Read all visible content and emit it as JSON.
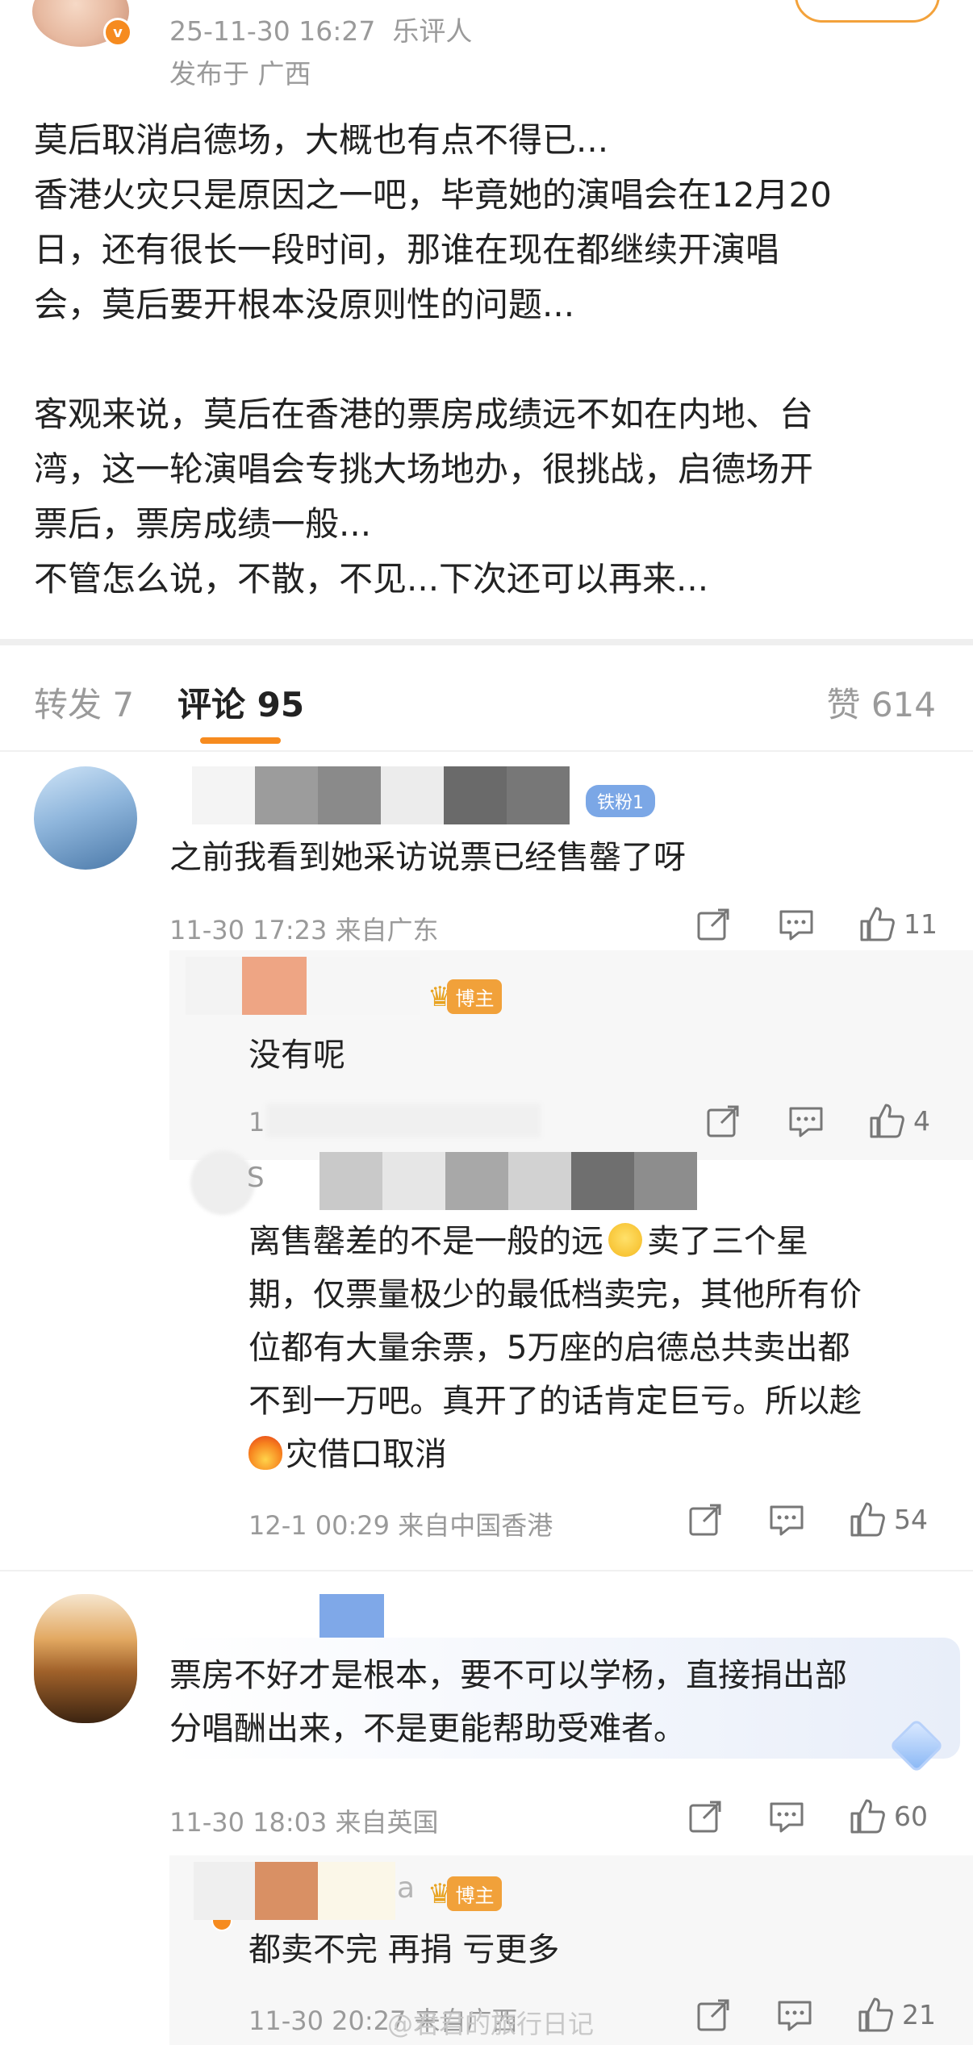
{
  "post": {
    "timestamp": "25-11-30 16:27",
    "source": "乐评人",
    "location": "发布于 广西",
    "body": [
      "莫后取消启德场，大概也有点不得已...",
      "香港火灾只是原因之一吧，毕竟她的演唱会在12月20",
      "日，还有很长一段时间，那谁在现在都继续开演唱",
      "会，莫后要开根本没原则性的问题...",
      "",
      "客观来说，莫后在香港的票房成绩远不如在内地、台",
      "湾，这一轮演唱会专挑大场地办，很挑战，启德场开",
      "票后，票房成绩一般...",
      "不管怎么说，不散，不见...下次还可以再来..."
    ]
  },
  "tabs": {
    "repost": "转发 7",
    "comments": "评论 95",
    "likes": "赞 614"
  },
  "comments": [
    {
      "badge": "铁粉1",
      "text": "之前我看到她采访说票已经售罄了呀",
      "meta": "11-30 17:23 来自广东",
      "likes": "11",
      "replies": [
        {
          "badge": "博主",
          "text": "没有呢",
          "meta": "1",
          "likes": "4"
        },
        {
          "name_initial": "S",
          "text_lines": [
            "离售罄差的不是一般的远",
            "卖了三个星",
            "期，仅票量极少的最低档卖完，其他所有价",
            "位都有大量余票，5万座的启德总共卖出都",
            "不到一万吧。真开了的话肯定巨亏。所以趁",
            "灾借口取消"
          ],
          "meta": "12-1 00:29 来自中国香港",
          "likes": "54"
        }
      ]
    },
    {
      "text_lines": [
        "票房不好才是根本，要不可以学杨，直接捐出部",
        "分唱酬出来，不是更能帮助受难者。"
      ],
      "meta": "11-30 18:03 来自英国",
      "likes": "60",
      "replies": [
        {
          "name_suffix": "a",
          "badge": "博主",
          "text": "都卖不完 再捐 亏更多",
          "meta": "11-30 20:27 来自广西",
          "likes": "21"
        }
      ]
    }
  ],
  "watermark": "@君君的旅行日记",
  "colors": {
    "accent": "#f68b1f",
    "fan_badge": "#7ba7e6",
    "blogger_badge": "#f1a13a"
  }
}
